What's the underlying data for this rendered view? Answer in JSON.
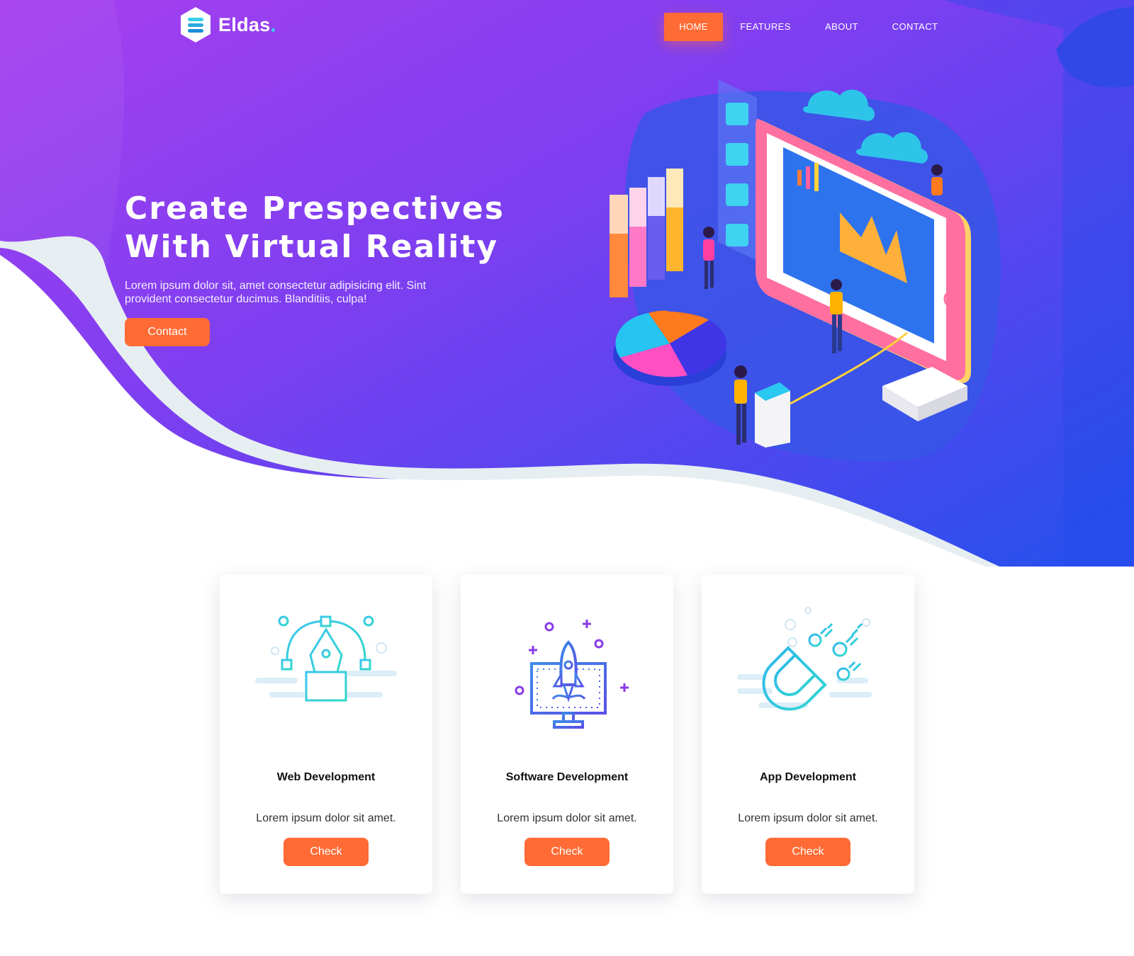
{
  "brand": {
    "name": "Eldas"
  },
  "nav": {
    "items": [
      {
        "label": "HOME",
        "active": true
      },
      {
        "label": "FEATURES",
        "active": false
      },
      {
        "label": "ABOUT",
        "active": false
      },
      {
        "label": "CONTACT",
        "active": false
      }
    ]
  },
  "hero": {
    "title_line1": "Create Prespectives",
    "title_line2": "With Virtual Reality",
    "text": "Lorem ipsum dolor sit, amet consectetur adipisicing elit. Sint provident consectetur ducimus. Blanditiis, culpa!",
    "button_label": "Contact"
  },
  "cards": [
    {
      "title": "Web Development",
      "text": "Lorem ipsum dolor sit amet.",
      "button_label": "Check",
      "icon": "pen-tool-icon"
    },
    {
      "title": "Software Development",
      "text": "Lorem ipsum dolor sit amet.",
      "button_label": "Check",
      "icon": "rocket-monitor-icon"
    },
    {
      "title": "App Development",
      "text": "Lorem ipsum dolor sit amet.",
      "button_label": "Check",
      "icon": "magnet-icon"
    }
  ],
  "colors": {
    "accent": "#ff6b35",
    "hero_gradient_start": "#a63ff0",
    "hero_gradient_end": "#2b4fee",
    "icon_cyan": "#35c6e8",
    "icon_blue": "#3d6de8",
    "icon_purple": "#8a3be8"
  }
}
